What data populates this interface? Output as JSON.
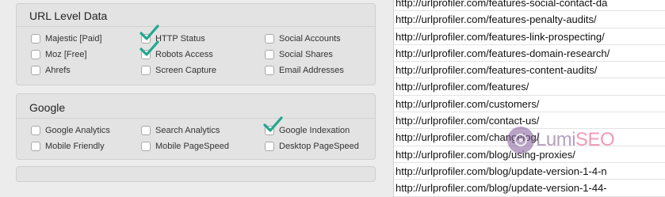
{
  "url_level_panel": {
    "title": "URL Level Data",
    "options": [
      {
        "label": "Majestic [Paid]",
        "checked": false
      },
      {
        "label": "HTTP Status",
        "checked": true
      },
      {
        "label": "Social Accounts",
        "checked": false
      },
      {
        "label": "Moz [Free]",
        "checked": false
      },
      {
        "label": "Robots Access",
        "checked": true
      },
      {
        "label": "Social Shares",
        "checked": false
      },
      {
        "label": "Ahrefs",
        "checked": false
      },
      {
        "label": "Screen Capture",
        "checked": false
      },
      {
        "label": "Email Addresses",
        "checked": false
      }
    ]
  },
  "google_panel": {
    "title": "Google",
    "options": [
      {
        "label": "Google Analytics",
        "checked": false
      },
      {
        "label": "Search Analytics",
        "checked": false
      },
      {
        "label": "Google Indexation",
        "checked": true
      },
      {
        "label": "Mobile Friendly",
        "checked": false
      },
      {
        "label": "Mobile PageSpeed",
        "checked": false
      },
      {
        "label": "Desktop PageSpeed",
        "checked": false
      }
    ]
  },
  "url_list": [
    "http://urlprofiler.com/features-social-contact-da",
    "http://urlprofiler.com/features-penalty-audits/",
    "http://urlprofiler.com/features-link-prospecting/",
    "http://urlprofiler.com/features-domain-research/",
    "http://urlprofiler.com/features-content-audits/",
    "http://urlprofiler.com/features/",
    "http://urlprofiler.com/customers/",
    "http://urlprofiler.com/contact-us/",
    "http://urlprofiler.com/changelog/",
    "http://urlprofiler.com/blog/using-proxies/",
    "http://urlprofiler.com/blog/update-version-1-4-n",
    "http://urlprofiler.com/blog/update-version-1-44-"
  ],
  "watermark": {
    "part1": "Lumi",
    "part2": "SEO"
  },
  "colors": {
    "check": "#1fa88f",
    "panel_bg": "#e3e3e3",
    "list_bg": "#ffffff"
  }
}
